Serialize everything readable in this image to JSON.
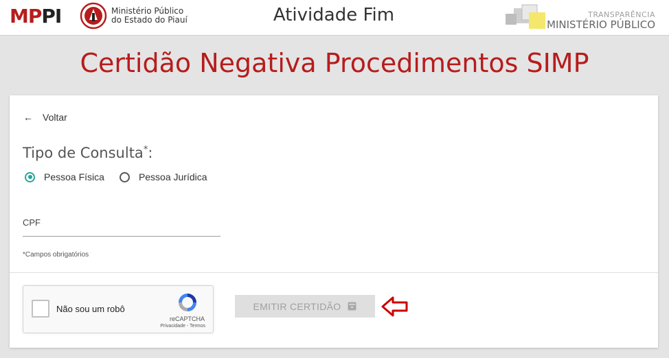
{
  "header": {
    "logo_mp": "MP",
    "logo_pi": "PI",
    "institution_line1": "Ministério Público",
    "institution_line2": "do Estado do Piauí",
    "title": "Atividade Fim",
    "transparency_top": "TRANSPARÊNCIA",
    "transparency_bottom": "MINISTÉRIO PÚBLICO"
  },
  "page_title": "Certidão Negativa Procedimentos SIMP",
  "form": {
    "back_label": "Voltar",
    "consulta_label": "Tipo de Consulta",
    "required_mark": "*",
    "colon": ":",
    "options": [
      {
        "label": "Pessoa Física",
        "selected": true
      },
      {
        "label": "Pessoa Jurídica",
        "selected": false
      }
    ],
    "cpf_label": "CPF",
    "cpf_value": "",
    "required_note": "*Campos obrigatórios"
  },
  "recaptcha": {
    "label": "Não sou um robô",
    "brand": "reCAPTCHA",
    "links": "Privacidade - Termos"
  },
  "actions": {
    "emit_label": "EMITIR CERTIDÃO",
    "emit_icon": "archive-icon",
    "emit_disabled": true
  },
  "colors": {
    "brand_red": "#b71c1c",
    "radio_accent": "#26a69a",
    "annotation_arrow": "#cc0000"
  }
}
